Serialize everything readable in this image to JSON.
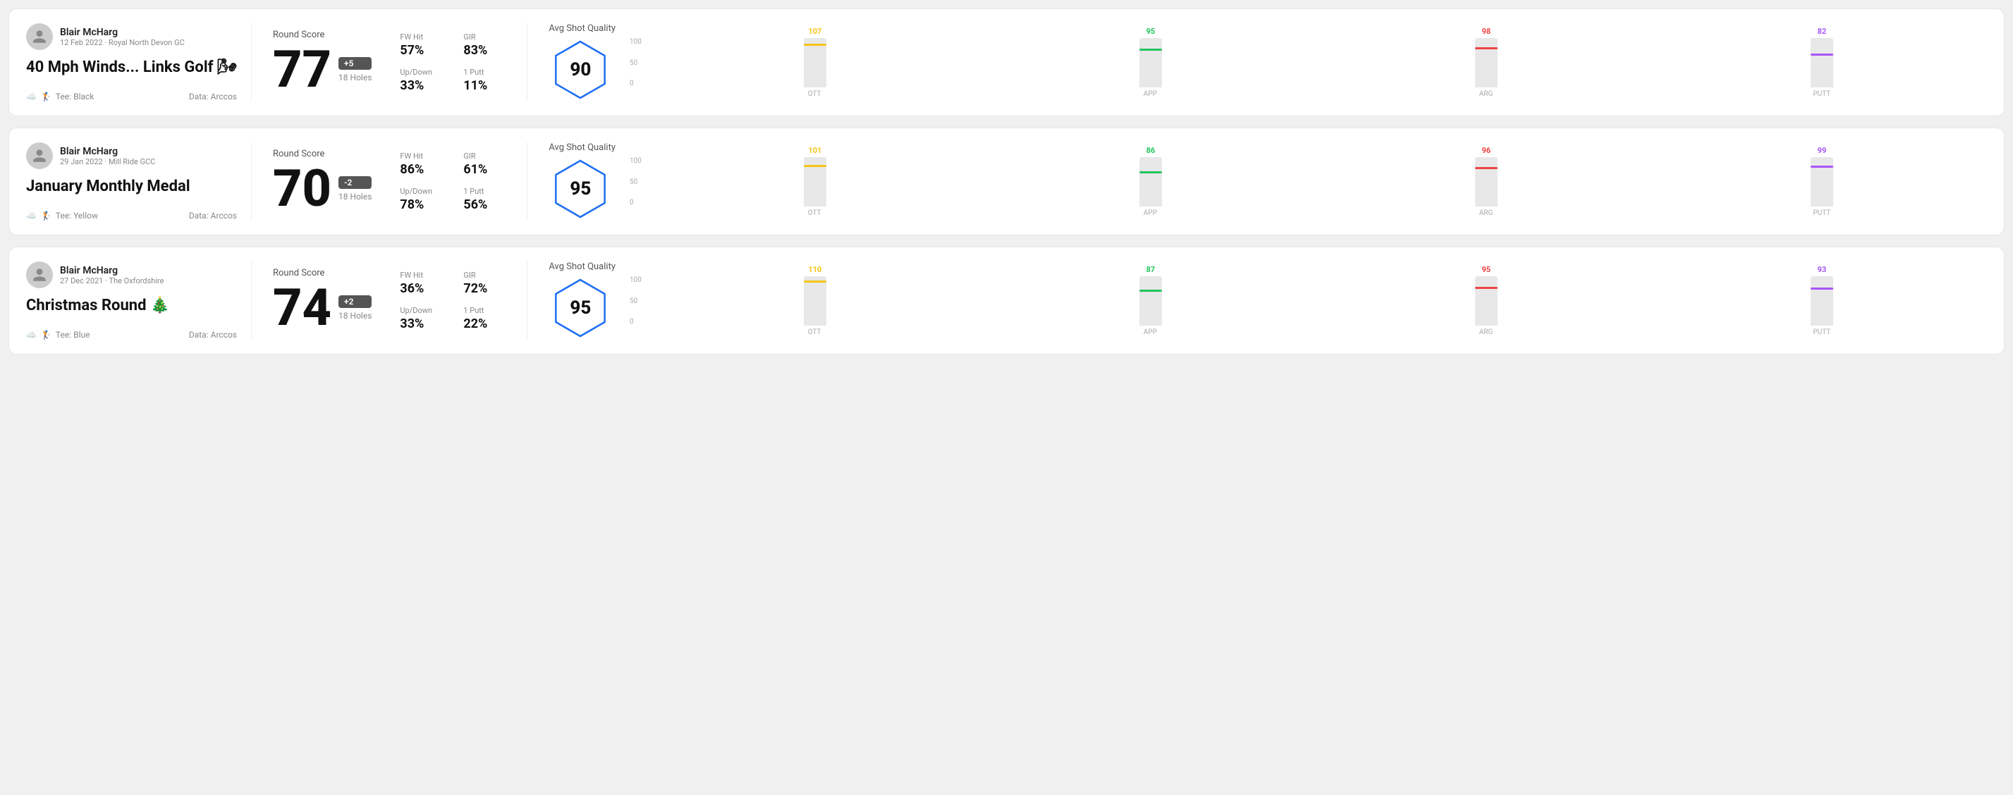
{
  "rounds": [
    {
      "id": "round-1",
      "user": {
        "name": "Blair McHarg",
        "date": "12 Feb 2022",
        "course": "Royal North Devon GC"
      },
      "title": "40 Mph Winds... Links Golf 🌬",
      "tee": "Black",
      "data_source": "Data: Arccos",
      "score": {
        "label": "Round Score",
        "number": "77",
        "badge": "+5",
        "badge_type": "positive",
        "holes": "18 Holes"
      },
      "stats": {
        "fw_hit_label": "FW Hit",
        "fw_hit_value": "57%",
        "gir_label": "GIR",
        "gir_value": "83%",
        "updown_label": "Up/Down",
        "updown_value": "33%",
        "oneputt_label": "1 Putt",
        "oneputt_value": "11%"
      },
      "quality": {
        "label": "Avg Shot Quality",
        "score": "90"
      },
      "chart": {
        "bars": [
          {
            "label": "OTT",
            "value": 107,
            "color": "#f5c518",
            "max": 120
          },
          {
            "label": "APP",
            "value": 95,
            "color": "#22c55e",
            "max": 120
          },
          {
            "label": "ARG",
            "value": 98,
            "color": "#ef4444",
            "max": 120
          },
          {
            "label": "PUTT",
            "value": 82,
            "color": "#a855f7",
            "max": 120
          }
        ],
        "y_labels": [
          "100",
          "50",
          "0"
        ]
      }
    },
    {
      "id": "round-2",
      "user": {
        "name": "Blair McHarg",
        "date": "29 Jan 2022",
        "course": "Mill Ride GCC"
      },
      "title": "January Monthly Medal",
      "tee": "Yellow",
      "data_source": "Data: Arccos",
      "score": {
        "label": "Round Score",
        "number": "70",
        "badge": "-2",
        "badge_type": "negative",
        "holes": "18 Holes"
      },
      "stats": {
        "fw_hit_label": "FW Hit",
        "fw_hit_value": "86%",
        "gir_label": "GIR",
        "gir_value": "61%",
        "updown_label": "Up/Down",
        "updown_value": "78%",
        "oneputt_label": "1 Putt",
        "oneputt_value": "56%"
      },
      "quality": {
        "label": "Avg Shot Quality",
        "score": "95"
      },
      "chart": {
        "bars": [
          {
            "label": "OTT",
            "value": 101,
            "color": "#f5c518",
            "max": 120
          },
          {
            "label": "APP",
            "value": 86,
            "color": "#22c55e",
            "max": 120
          },
          {
            "label": "ARG",
            "value": 96,
            "color": "#ef4444",
            "max": 120
          },
          {
            "label": "PUTT",
            "value": 99,
            "color": "#a855f7",
            "max": 120
          }
        ],
        "y_labels": [
          "100",
          "50",
          "0"
        ]
      }
    },
    {
      "id": "round-3",
      "user": {
        "name": "Blair McHarg",
        "date": "27 Dec 2021",
        "course": "The Oxfordshire"
      },
      "title": "Christmas Round 🎄",
      "tee": "Blue",
      "data_source": "Data: Arccos",
      "score": {
        "label": "Round Score",
        "number": "74",
        "badge": "+2",
        "badge_type": "positive",
        "holes": "18 Holes"
      },
      "stats": {
        "fw_hit_label": "FW Hit",
        "fw_hit_value": "36%",
        "gir_label": "GIR",
        "gir_value": "72%",
        "updown_label": "Up/Down",
        "updown_value": "33%",
        "oneputt_label": "1 Putt",
        "oneputt_value": "22%"
      },
      "quality": {
        "label": "Avg Shot Quality",
        "score": "95"
      },
      "chart": {
        "bars": [
          {
            "label": "OTT",
            "value": 110,
            "color": "#f5c518",
            "max": 120
          },
          {
            "label": "APP",
            "value": 87,
            "color": "#22c55e",
            "max": 120
          },
          {
            "label": "ARG",
            "value": 95,
            "color": "#ef4444",
            "max": 120
          },
          {
            "label": "PUTT",
            "value": 93,
            "color": "#a855f7",
            "max": 120
          }
        ],
        "y_labels": [
          "100",
          "50",
          "0"
        ]
      }
    }
  ]
}
